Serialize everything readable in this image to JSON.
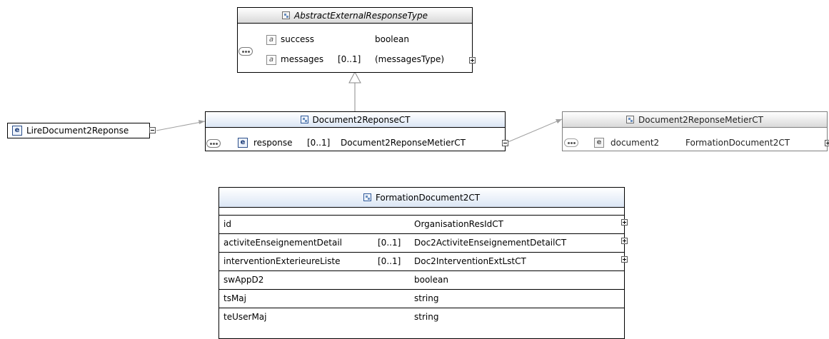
{
  "abstract_type": {
    "title": "AbstractExternalResponseType",
    "attributes": [
      {
        "name": "success",
        "multiplicity": "",
        "type": "boolean"
      },
      {
        "name": "messages",
        "multiplicity": "[0..1]",
        "type": "(messagesType)"
      }
    ]
  },
  "root_element": {
    "label": "LireDocument2Reponse",
    "badge": "e"
  },
  "reponse_ct": {
    "title": "Document2ReponseCT",
    "element": {
      "badge": "e",
      "name": "response",
      "multiplicity": "[0..1]",
      "type": "Document2ReponseMetierCT"
    }
  },
  "metier_ct": {
    "title": "Document2ReponseMetierCT",
    "element": {
      "badge": "e",
      "name": "document2",
      "type": "FormationDocument2CT"
    }
  },
  "formation_ct": {
    "title": "FormationDocument2CT",
    "rows": [
      {
        "name": "id",
        "multiplicity": "",
        "type": "OrganisationResIdCT",
        "expandable": true
      },
      {
        "name": "activiteEnseignementDetail",
        "multiplicity": "[0..1]",
        "type": "Doc2ActiviteEnseignementDetailCT",
        "expandable": true
      },
      {
        "name": "interventionExterieureListe",
        "multiplicity": "[0..1]",
        "type": "Doc2InterventionExtLstCT",
        "expandable": true
      },
      {
        "name": "swAppD2",
        "multiplicity": "",
        "type": "boolean",
        "expandable": false
      },
      {
        "name": "tsMaj",
        "multiplicity": "",
        "type": "string",
        "expandable": false
      },
      {
        "name": "teUserMaj",
        "multiplicity": "",
        "type": "string",
        "expandable": false
      }
    ]
  }
}
